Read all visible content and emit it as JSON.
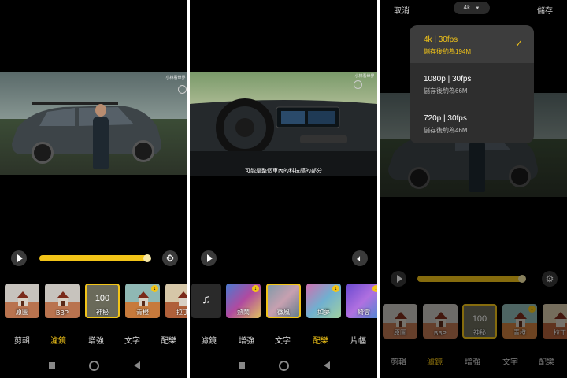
{
  "panel1": {
    "watermark": "小林看世界",
    "tiles": [
      {
        "label": "原圖",
        "selected": false,
        "badge": false
      },
      {
        "label": "BBP",
        "selected": false,
        "badge": false
      },
      {
        "label": "神秘",
        "big": "100",
        "selected": true,
        "badge": false
      },
      {
        "label": "青橙",
        "selected": false,
        "badge": true
      },
      {
        "label": "拉丁",
        "selected": false,
        "badge": false
      }
    ],
    "tabs": [
      "剪輯",
      "濾鏡",
      "增強",
      "文字",
      "配樂"
    ],
    "active_tab": "濾鏡"
  },
  "panel2": {
    "watermark": "小林看世界",
    "subtitle": "可能是整個車內的科技感的部分",
    "tiles": [
      {
        "label": "",
        "icon": "music-note-icon"
      },
      {
        "label": "熱鬧",
        "badge": true
      },
      {
        "label": "微風",
        "selected": true
      },
      {
        "label": "如夢",
        "badge": true
      },
      {
        "label": "綺雲",
        "badge": true
      }
    ],
    "tabs": [
      "濾鏡",
      "增強",
      "文字",
      "配樂",
      "片幅"
    ],
    "active_tab": "配樂"
  },
  "panel3": {
    "cancel": "取消",
    "save": "儲存",
    "resolution_chip": "4k",
    "options": [
      {
        "title": "4k | 30fps",
        "sub": "儲存後約為194M",
        "selected": true
      },
      {
        "title": "1080p | 30fps",
        "sub": "儲存後約為66M",
        "selected": false
      },
      {
        "title": "720p | 30fps",
        "sub": "儲存後約為46M",
        "selected": false
      }
    ],
    "tiles": [
      {
        "label": "原圖"
      },
      {
        "label": "BBP"
      },
      {
        "label": "神秘",
        "big": "100",
        "selected": true
      },
      {
        "label": "青橙",
        "badge": true
      },
      {
        "label": "拉丁"
      }
    ],
    "tabs": [
      "剪輯",
      "濾鏡",
      "增強",
      "文字",
      "配樂"
    ],
    "active_tab": "濾鏡"
  },
  "colors": {
    "accent": "#f2c418",
    "background": "#000000"
  }
}
